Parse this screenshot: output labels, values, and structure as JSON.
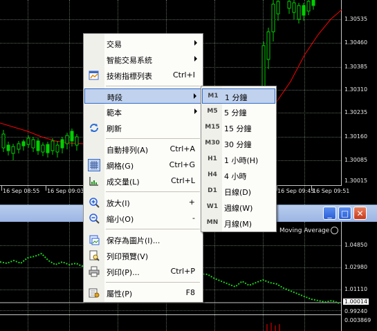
{
  "main_chart": {
    "price_labels": [
      "1.30535",
      "1.30460",
      "1.30385",
      "1.30310",
      "1.30235",
      "1.30160",
      "1.30085",
      "1.30015"
    ],
    "time_labels": [
      "16 Sep 08:55",
      "16 Sep 09:03",
      "16 Sep 09:43",
      "16 Sep 09:51"
    ]
  },
  "lower_window": {
    "indicator_label": "Moving Average",
    "price_labels": [
      "1.04850",
      "1.02980",
      "1.01110",
      "1.00014",
      "0.99240",
      "0.003869"
    ]
  },
  "context_menu": {
    "items": [
      {
        "label": "交易",
        "shortcut": "",
        "submenu": true,
        "icon": ""
      },
      {
        "label": "智能交易系統",
        "shortcut": "",
        "submenu": true,
        "icon": ""
      },
      {
        "label": "技術指標列表",
        "shortcut": "Ctrl+I",
        "submenu": false,
        "icon": "indicator-list-icon"
      },
      {
        "label": "時段",
        "shortcut": "",
        "submenu": true,
        "icon": ""
      },
      {
        "label": "範本",
        "shortcut": "",
        "submenu": true,
        "icon": ""
      },
      {
        "label": "刷新",
        "shortcut": "",
        "submenu": false,
        "icon": "refresh-icon"
      },
      {
        "label": "自動排列(A)",
        "shortcut": "Ctrl+A",
        "submenu": false,
        "icon": ""
      },
      {
        "label": "網格(G)",
        "shortcut": "Ctrl+G",
        "submenu": false,
        "icon": "grid-icon"
      },
      {
        "label": "成交量(L)",
        "shortcut": "Ctrl+L",
        "submenu": false,
        "icon": "volume-icon"
      },
      {
        "label": "放大(I)",
        "shortcut": "+",
        "submenu": false,
        "icon": "zoom-in-icon"
      },
      {
        "label": "縮小(O)",
        "shortcut": "-",
        "submenu": false,
        "icon": "zoom-out-icon"
      },
      {
        "label": "保存為圖片(I)...",
        "shortcut": "",
        "submenu": false,
        "icon": "save-picture-icon"
      },
      {
        "label": "列印預覽(V)",
        "shortcut": "",
        "submenu": false,
        "icon": "print-preview-icon"
      },
      {
        "label": "列印(P)...",
        "shortcut": "Ctrl+P",
        "submenu": false,
        "icon": "print-icon"
      },
      {
        "label": "屬性(P)",
        "shortcut": "F8",
        "submenu": false,
        "icon": "properties-icon"
      }
    ]
  },
  "timeframe_menu": {
    "items": [
      {
        "code": "M1",
        "label": "1 分鐘"
      },
      {
        "code": "M5",
        "label": "5 分鐘"
      },
      {
        "code": "M15",
        "label": "15 分鐘"
      },
      {
        "code": "M30",
        "label": "30 分鐘"
      },
      {
        "code": "H1",
        "label": "1 小時(H)"
      },
      {
        "code": "H4",
        "label": "4 小時"
      },
      {
        "code": "D1",
        "label": "日線(D)"
      },
      {
        "code": "W1",
        "label": "週線(W)"
      },
      {
        "code": "MN",
        "label": "月線(M)"
      }
    ]
  },
  "window_buttons": {
    "minimize": "_",
    "maximize": "□",
    "close": "✕"
  },
  "colors": {
    "chart_bg": "#000000",
    "candle": "#00d000",
    "ma_line": "#ff0000",
    "highlight": "#c1d2ee",
    "titlebar": "#9bb5e3"
  }
}
